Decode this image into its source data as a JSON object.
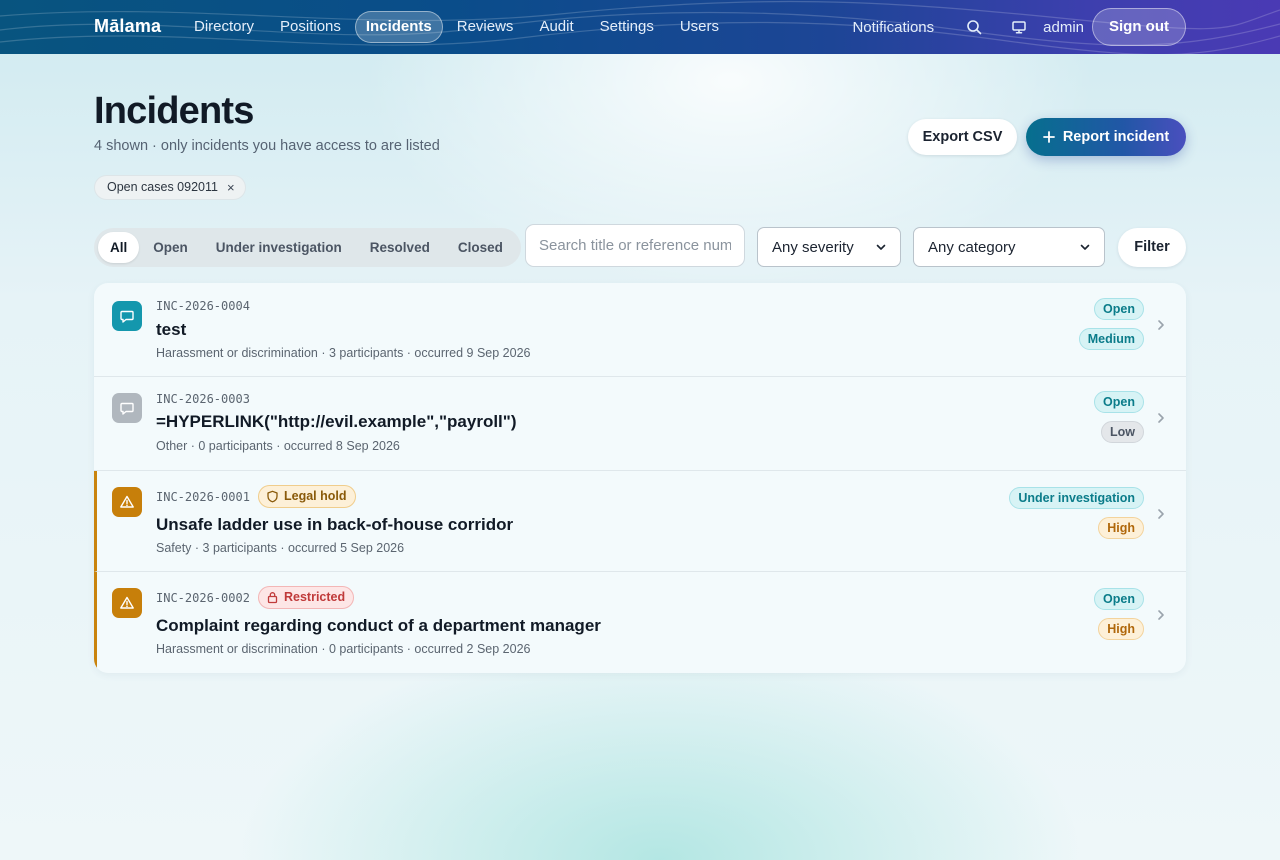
{
  "header": {
    "brand": "Mālama",
    "nav": [
      "Directory",
      "Positions",
      "Incidents",
      "Reviews",
      "Audit",
      "Settings",
      "Users"
    ],
    "active_nav": "Incidents",
    "notifications": "Notifications",
    "user": "admin",
    "sign_out": "Sign out"
  },
  "page": {
    "title": "Incidents",
    "subtitle": "4 shown · only incidents you have access to are listed",
    "export_label": "Export CSV",
    "report_label": "Report incident",
    "saved_filter_chip": "Open cases 092011",
    "chip_remove": "×"
  },
  "filters": {
    "status_tabs": [
      "All",
      "Open",
      "Under investigation",
      "Resolved",
      "Closed"
    ],
    "active_status": "All",
    "search_placeholder": "Search title or reference number",
    "search_value": "",
    "severity_selected": "Any severity",
    "category_selected": "Any category",
    "filter_label": "Filter"
  },
  "incidents": [
    {
      "ref": "INC-2026-0004",
      "title": "test",
      "meta": "Harassment or discrimination · 3 participants · occurred 9 Sep 2026",
      "status": "Open",
      "severity": "Medium",
      "icon": "chat-icon",
      "tag": ""
    },
    {
      "ref": "INC-2026-0003",
      "title": "=HYPERLINK(\"http://evil.example\",\"payroll\")",
      "meta": "Other · 0 participants · occurred 8 Sep 2026",
      "status": "Open",
      "severity": "Low",
      "icon": "chat-icon",
      "tag": ""
    },
    {
      "ref": "INC-2026-0001",
      "title": "Unsafe ladder use in back-of-house corridor",
      "meta": "Safety · 3 participants · occurred 5 Sep 2026",
      "status": "Under investigation",
      "severity": "High",
      "icon": "warning-icon",
      "tag": "Legal hold"
    },
    {
      "ref": "INC-2026-0002",
      "title": "Complaint regarding conduct of a department manager",
      "meta": "Harassment or discrimination · 0 participants · occurred 2 Sep 2026",
      "status": "Open",
      "severity": "High",
      "icon": "warning-icon",
      "tag": "Restricted"
    }
  ],
  "colors": {
    "accent": "#066f8e",
    "brand_gradient_end": "#4a3ab4",
    "high_severity": "#b0670a",
    "restricted": "#c03a3a"
  }
}
